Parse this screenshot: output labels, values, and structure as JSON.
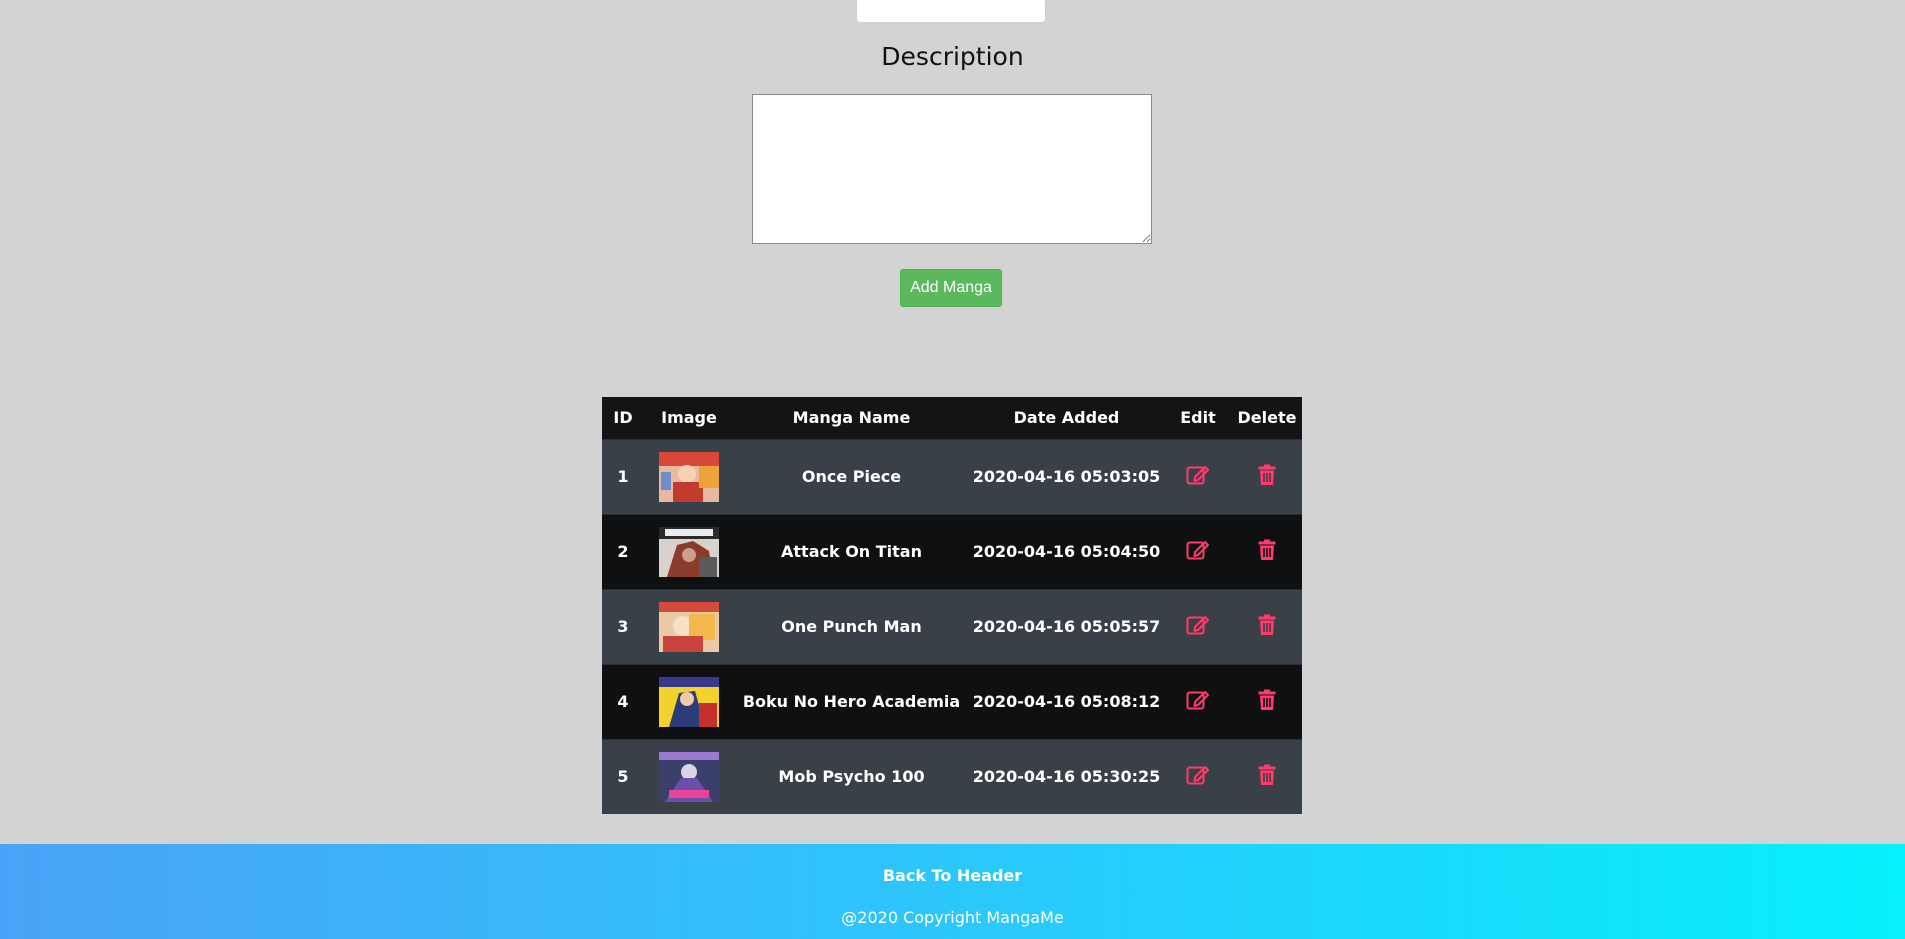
{
  "form": {
    "description_label": "Description",
    "description_value": "",
    "add_button_label": "Add Manga"
  },
  "table": {
    "headers": {
      "id": "ID",
      "image": "Image",
      "name": "Manga Name",
      "date": "Date Added",
      "edit": "Edit",
      "delete": "Delete"
    },
    "rows": [
      {
        "id": "1",
        "name": "Once Piece",
        "date": "2020-04-16 05:03:05"
      },
      {
        "id": "2",
        "name": "Attack On Titan",
        "date": "2020-04-16 05:04:50"
      },
      {
        "id": "3",
        "name": "One Punch Man",
        "date": "2020-04-16 05:05:57"
      },
      {
        "id": "4",
        "name": "Boku No Hero Academia",
        "date": "2020-04-16 05:08:12"
      },
      {
        "id": "5",
        "name": "Mob Psycho 100",
        "date": "2020-04-16 05:30:25"
      }
    ]
  },
  "icons": {
    "edit": "edit-icon",
    "delete": "trash-icon",
    "icon_color": "#ff3b6b"
  },
  "footer": {
    "back_link": "Back To Header",
    "copyright": "@2020 Copyright MangaMe"
  }
}
